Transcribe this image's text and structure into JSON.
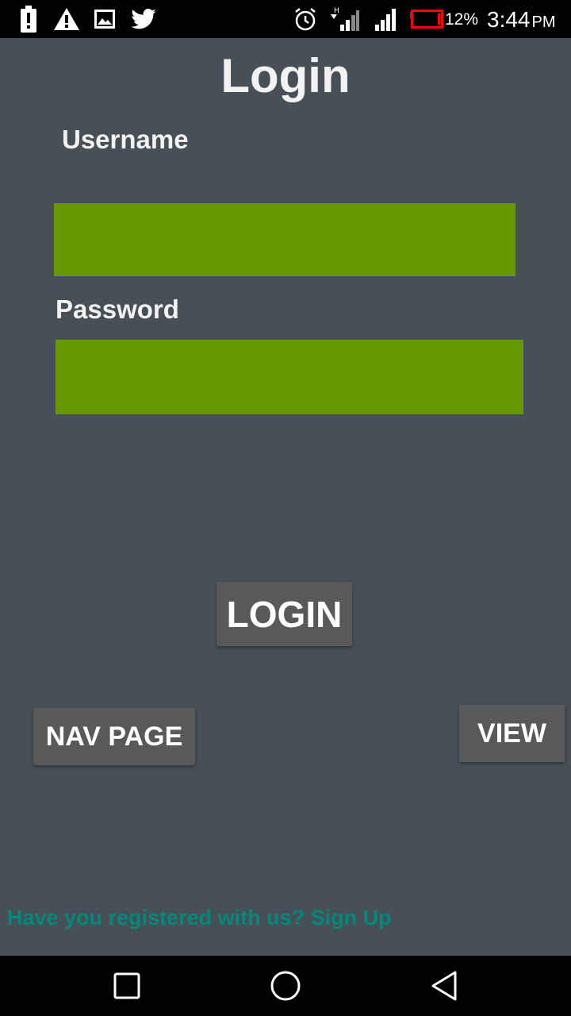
{
  "status_bar": {
    "icons": [
      "battery-alert-icon",
      "warning-icon",
      "image-icon",
      "twitter-icon",
      "alarm-icon",
      "signal-h-icon",
      "signal-icon",
      "battery-low-icon"
    ],
    "battery_percent": "12%",
    "time": "3:44",
    "ampm": "PM",
    "battery_color": "#ff0000"
  },
  "login": {
    "title": "Login",
    "username_label": "Username",
    "username_value": "",
    "password_label": "Password",
    "password_value": "",
    "login_button": "LOGIN",
    "nav_page_button": "NAV PAGE",
    "view_button": "VIEW",
    "signup_text": "Have you registered with us? Sign Up"
  },
  "nav_bar": {
    "icons": [
      "recents-icon",
      "home-icon",
      "back-icon"
    ]
  },
  "colors": {
    "background": "#465056",
    "field": "#669900",
    "button": "#595959",
    "link": "#00897b"
  }
}
